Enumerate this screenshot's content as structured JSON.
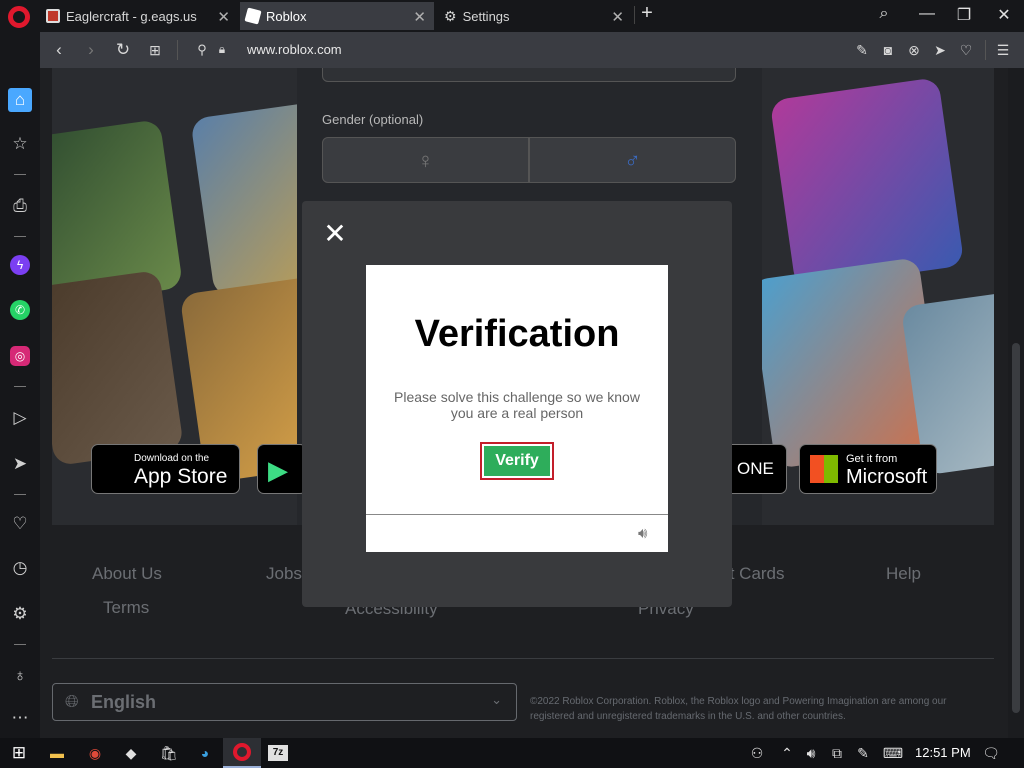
{
  "tabs": [
    {
      "title": "Eaglercraft - g.eags.us"
    },
    {
      "title": "Roblox"
    },
    {
      "title": "Settings"
    }
  ],
  "address_bar": {
    "url": "www.roblox.com"
  },
  "page": {
    "gender_label": "Gender (optional)",
    "store_buttons": {
      "app_store_small": "Download on the",
      "app_store_big": "App Store",
      "xbox_partial": "ONE",
      "microsoft_small": "Get it from",
      "microsoft_big": "Microsoft"
    },
    "footer_links": [
      "About Us",
      "Jobs",
      "ft Cards",
      "Help",
      "Terms",
      "Accessibility",
      "Privacy"
    ],
    "language": "English",
    "copyright": "©2022 Roblox Corporation. Roblox, the Roblox logo and Powering Imagination are among our registered and unregistered trademarks in the U.S. and other countries."
  },
  "modal": {
    "title": "Verification",
    "message": "Please solve this challenge so we know you are a real person",
    "verify_label": "Verify"
  },
  "taskbar": {
    "time": "12:51 PM"
  },
  "colors": {
    "accent_red": "#e0182d",
    "verify_green": "#2ead5b",
    "verify_border": "#c31e2a"
  }
}
